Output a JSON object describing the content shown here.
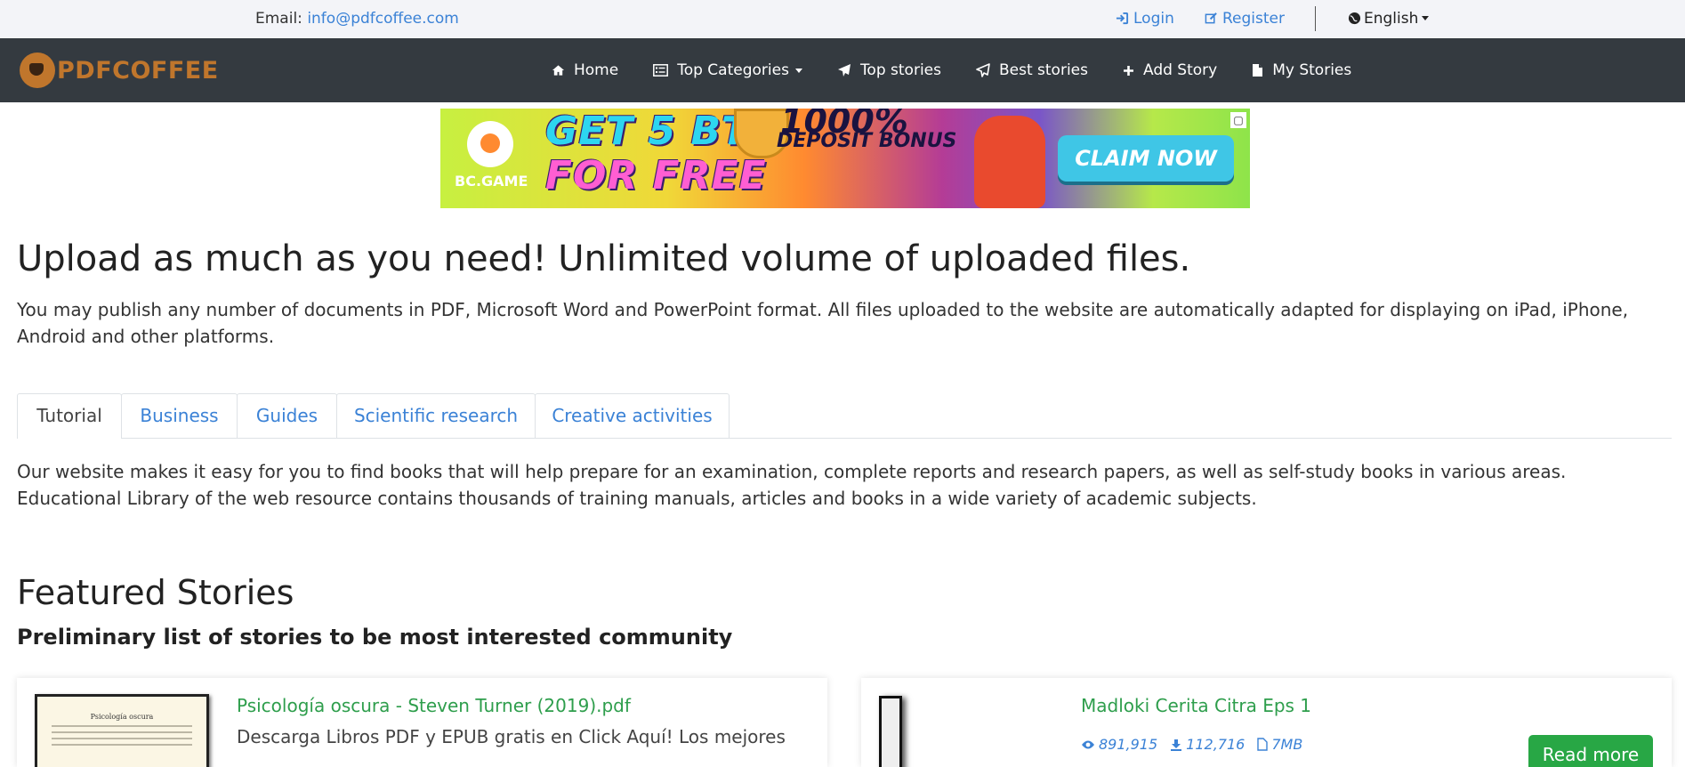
{
  "topbar": {
    "email_label": "Email:",
    "email": "info@pdfcoffee.com",
    "login": "Login",
    "register": "Register",
    "language": "English"
  },
  "nav": {
    "logo_text": "PDFCOFFEE",
    "items": [
      {
        "label": "Home",
        "icon": "home-icon"
      },
      {
        "label": "Top Categories",
        "icon": "list-icon",
        "dropdown": true
      },
      {
        "label": "Top stories",
        "icon": "paper-plane-icon"
      },
      {
        "label": "Best stories",
        "icon": "paper-plane-outline-icon"
      },
      {
        "label": "Add Story",
        "icon": "plus-icon"
      },
      {
        "label": "My Stories",
        "icon": "file-icon"
      }
    ]
  },
  "ad": {
    "brand": "BC.GAME",
    "line1": "GET 5 BTC",
    "line2": "FOR FREE",
    "bonus_top": "1000%",
    "bonus_bottom": "DEPOSIT BONUS",
    "cta": "CLAIM NOW"
  },
  "hero": {
    "title": "Upload as much as you need! Unlimited volume of uploaded files.",
    "text": "You may publish any number of documents in PDF, Microsoft Word and PowerPoint format. All files uploaded to the website are automatically adapted for displaying on iPad, iPhone, Android and other platforms."
  },
  "tabs": {
    "items": [
      "Tutorial",
      "Business",
      "Guides",
      "Scientific research",
      "Creative activities"
    ],
    "active": "Tutorial",
    "content": "Our website makes it easy for you to find books that will help prepare for an examination, complete reports and research papers, as well as self-study books in various areas. Educational Library of the web resource contains thousands of training manuals, articles and books in a wide variety of academic subjects."
  },
  "featured": {
    "title": "Featured Stories",
    "subtitle": "Preliminary list of stories to be most interested community",
    "cards": [
      {
        "title": "Psicología oscura - Steven Turner (2019).pdf",
        "description": "Descarga Libros PDF y EPUB gratis en Click Aquí! Los mejores",
        "thumb_title": "Psicología oscura"
      },
      {
        "title": "Madloki Cerita Citra Eps 1",
        "views": "891,915",
        "downloads": "112,716",
        "size": "7MB",
        "button": "Read more"
      }
    ]
  },
  "colors": {
    "link": "#3b82d6",
    "nav_bg": "#343a40",
    "brand": "#c0762c",
    "card_title": "#2e9e4c",
    "button": "#28a745"
  }
}
